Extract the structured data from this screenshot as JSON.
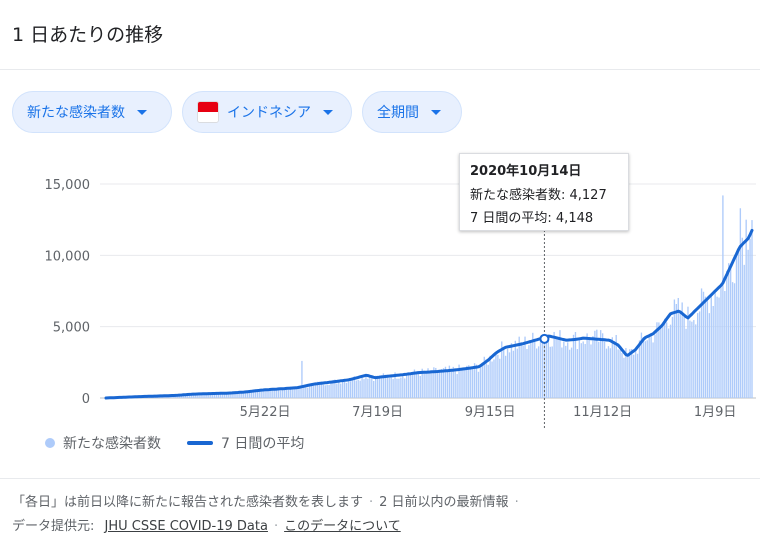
{
  "header": {
    "title": "1 日あたりの推移"
  },
  "filters": [
    {
      "label": "新たな感染者数"
    },
    {
      "label": "インドネシア"
    },
    {
      "label": "全期間"
    }
  ],
  "tooltip": {
    "date": "2020年10月14日",
    "line1": "新たな感染者数: 4,127",
    "line2": "7 日間の平均: 4,148"
  },
  "legend": {
    "bars": "新たな感染者数",
    "avg": "7 日間の平均"
  },
  "footer": {
    "note": "「各日」は前日以降に新たに報告された感染者数を表します",
    "note2": "2 日前以内の最新情報",
    "source_label": "データ提供元:",
    "source_link": "JHU CSSE COVID-19 Data",
    "about_link": "このデータについて"
  },
  "colors": {
    "bar": "#aecbfa",
    "line": "#1967d2",
    "accent": "#1a73e8",
    "flag_red": "#e70011"
  },
  "chart_data": {
    "type": "bar",
    "title": "",
    "xlabel": "",
    "ylabel": "",
    "ylim": [
      0,
      16500
    ],
    "y_ticks": [
      0,
      5000,
      10000,
      15000
    ],
    "y_tick_labels": [
      "0",
      "5,000",
      "10,000",
      "15,000"
    ],
    "x_tick_labels": [
      "5月22日",
      "7月19日",
      "9月15日",
      "11月12日",
      "1月9日"
    ],
    "x_tick_day_index": [
      82,
      140,
      198,
      256,
      314
    ],
    "num_days": 334,
    "highlight_day_index": 226,
    "series": [
      {
        "name": "7 日間の平均",
        "type": "line",
        "points": [
          [
            0,
            0
          ],
          [
            20,
            100
          ],
          [
            40,
            180
          ],
          [
            50,
            270
          ],
          [
            60,
            310
          ],
          [
            70,
            340
          ],
          [
            80,
            420
          ],
          [
            90,
            560
          ],
          [
            100,
            640
          ],
          [
            110,
            720
          ],
          [
            120,
            980
          ],
          [
            130,
            1120
          ],
          [
            140,
            1280
          ],
          [
            150,
            1600
          ],
          [
            155,
            1420
          ],
          [
            160,
            1500
          ],
          [
            170,
            1620
          ],
          [
            180,
            1780
          ],
          [
            190,
            1850
          ],
          [
            200,
            1950
          ],
          [
            210,
            2100
          ],
          [
            215,
            2200
          ],
          [
            220,
            2650
          ],
          [
            225,
            3200
          ],
          [
            230,
            3550
          ],
          [
            240,
            3800
          ],
          [
            250,
            4150
          ],
          [
            255,
            4350
          ],
          [
            260,
            4200
          ],
          [
            265,
            4050
          ],
          [
            270,
            4100
          ],
          [
            275,
            4200
          ],
          [
            280,
            4150
          ],
          [
            285,
            4100
          ],
          [
            290,
            4050
          ],
          [
            295,
            3700
          ],
          [
            300,
            2950
          ],
          [
            305,
            3400
          ],
          [
            310,
            4200
          ],
          [
            315,
            4500
          ],
          [
            320,
            5050
          ],
          [
            325,
            5900
          ],
          [
            330,
            6100
          ],
          [
            335,
            5600
          ],
          [
            340,
            6200
          ],
          [
            345,
            6800
          ],
          [
            350,
            7400
          ],
          [
            355,
            8000
          ],
          [
            360,
            9300
          ],
          [
            365,
            10600
          ],
          [
            370,
            11200
          ],
          [
            372,
            11750
          ]
        ]
      },
      {
        "name": "新たな感染者数",
        "type": "bar"
      }
    ]
  }
}
